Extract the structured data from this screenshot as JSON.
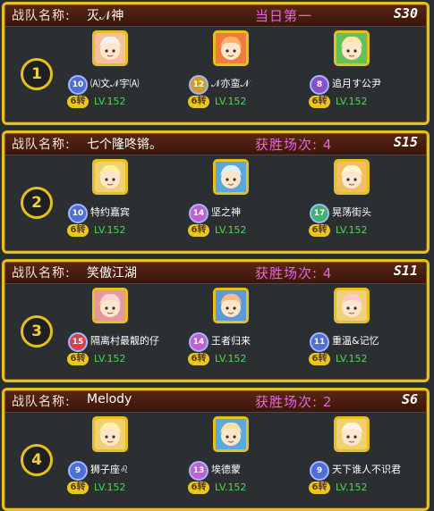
{
  "labels": {
    "team_label": "战队名称:",
    "rebirth": "6转"
  },
  "teams": [
    {
      "rank": "1",
      "name": "灭𝒩神",
      "stat": "当日第一",
      "server": "S30",
      "members": [
        {
          "name": "🄐文𝒩宇🄐",
          "level_badge": "10",
          "level": "LV.152",
          "badge_color": "#4f6fd8",
          "avatar_bg": "#f5c09a",
          "hair": "#f2f2f2"
        },
        {
          "name": "𝒩亦蛮𝒩",
          "level_badge": "12",
          "level": "LV.152",
          "badge_color": "#d49a2a",
          "avatar_bg": "#f07b3a",
          "hair": "#ffb070"
        },
        {
          "name": "追月す公尹",
          "level_badge": "8",
          "level": "LV.152",
          "badge_color": "#8a4fc8",
          "avatar_bg": "#64c05a",
          "hair": "#ffe8b0"
        }
      ]
    },
    {
      "rank": "2",
      "name": "七个隆咚锵。",
      "stat": "获胜场次: 4",
      "server": "S15",
      "members": [
        {
          "name": "特约嘉宾",
          "level_badge": "10",
          "level": "LV.152",
          "badge_color": "#4f6fd8",
          "avatar_bg": "#f0d070",
          "hair": "#fff0a0"
        },
        {
          "name": "坚之神",
          "level_badge": "14",
          "level": "LV.152",
          "badge_color": "#c060d0",
          "avatar_bg": "#5aa8d8",
          "hair": "#d8f0ff"
        },
        {
          "name": "晃荡街头",
          "level_badge": "17",
          "level": "LV.152",
          "badge_color": "#3fb36a",
          "avatar_bg": "#f0c060",
          "hair": "#fff4d0"
        }
      ]
    },
    {
      "rank": "3",
      "name": "笑傲江湖",
      "stat": "获胜场次: 4",
      "server": "S11",
      "members": [
        {
          "name": "隔离村最靓的仔",
          "level_badge": "15",
          "level": "LV.152",
          "badge_color": "#d8404a",
          "avatar_bg": "#e89898",
          "hair": "#ffd0d8"
        },
        {
          "name": "王者归来",
          "level_badge": "14",
          "level": "LV.152",
          "badge_color": "#c060d0",
          "avatar_bg": "#5a9ad8",
          "hair": "#ffb888"
        },
        {
          "name": "重温&记忆",
          "level_badge": "11",
          "level": "LV.152",
          "badge_color": "#4f6fd8",
          "avatar_bg": "#f0d078",
          "hair": "#ffc8c8"
        }
      ]
    },
    {
      "rank": "4",
      "name": "Melody",
      "stat": "获胜场次: 2",
      "server": "S6",
      "members": [
        {
          "name": "狮子座♌",
          "level_badge": "9",
          "level": "LV.152",
          "badge_color": "#4f6fd8",
          "avatar_bg": "#f0d070",
          "hair": "#fff0b0"
        },
        {
          "name": "埃德蒙",
          "level_badge": "13",
          "level": "LV.152",
          "badge_color": "#c060d0",
          "avatar_bg": "#5aa8e0",
          "hair": "#f8e0a0"
        },
        {
          "name": "天下谁人不识君",
          "level_badge": "9",
          "level": "LV.152",
          "badge_color": "#4f6fd8",
          "avatar_bg": "#f0d070",
          "hair": "#fff4e0"
        }
      ]
    }
  ]
}
